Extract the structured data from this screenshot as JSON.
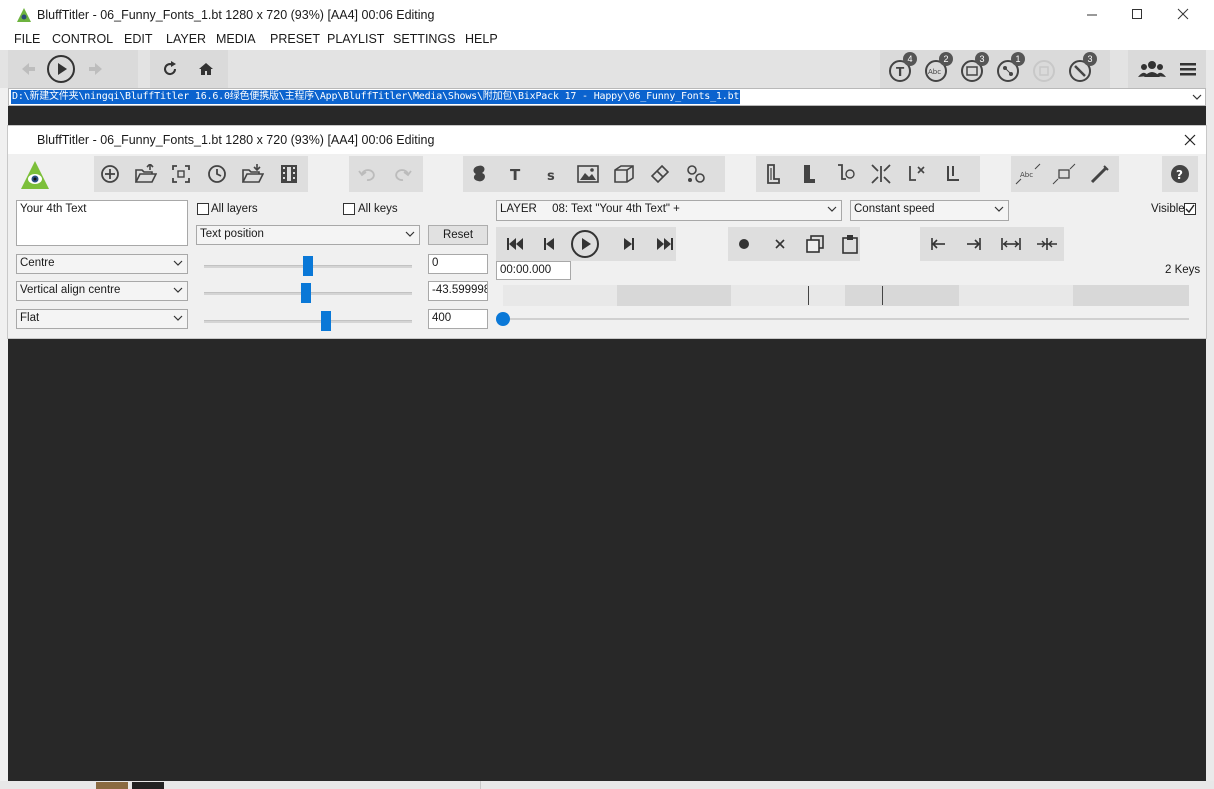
{
  "main_window": {
    "title": "BluffTitler - 06_Funny_Fonts_1.bt 1280 x 720 (93%) [AA4] 00:06 Editing",
    "menu": [
      "FILE",
      "CONTROL",
      "EDIT",
      "LAYER",
      "MEDIA",
      "PRESET",
      "PLAYLIST",
      "SETTINGS",
      "HELP"
    ],
    "toolbar_badges": [
      "4",
      "2",
      "3",
      "1",
      "3"
    ],
    "path": "D:\\新建文件夹\\ningqi\\BluffTitler 16.6.0绿色便携版\\主程序\\App\\BluffTitler\\Media\\Shows\\附加包\\BixPack 17 - Happy\\06_Funny_Fonts_1.bt"
  },
  "editor": {
    "title": "BluffTitler - 06_Funny_Fonts_1.bt 1280 x 720 (93%) [AA4] 00:06 Editing",
    "text_value": "Your 4th Text",
    "all_layers_label": "All layers",
    "all_keys_label": "All keys",
    "property_select": "Text position",
    "reset_label": "Reset",
    "layer_prefix": "LAYER",
    "layer_select": "08: Text \"Your 4th Text\" +",
    "speed_select": "Constant speed",
    "visible_label": "Visible",
    "visible_checked": true,
    "align_h": "Centre",
    "align_v": "Vertical align centre",
    "style": "Flat",
    "value_x": "0",
    "value_y": "-43.599998",
    "value_z": "400",
    "slider_fractions": [
      0.5,
      0.49,
      0.59
    ],
    "time": "00:00.000",
    "keys_label": "2 Keys",
    "timeline_position": 0.0
  },
  "colors": {
    "accent": "#0a78d7",
    "selection": "#0b63ce",
    "dark_area": "#282828"
  }
}
